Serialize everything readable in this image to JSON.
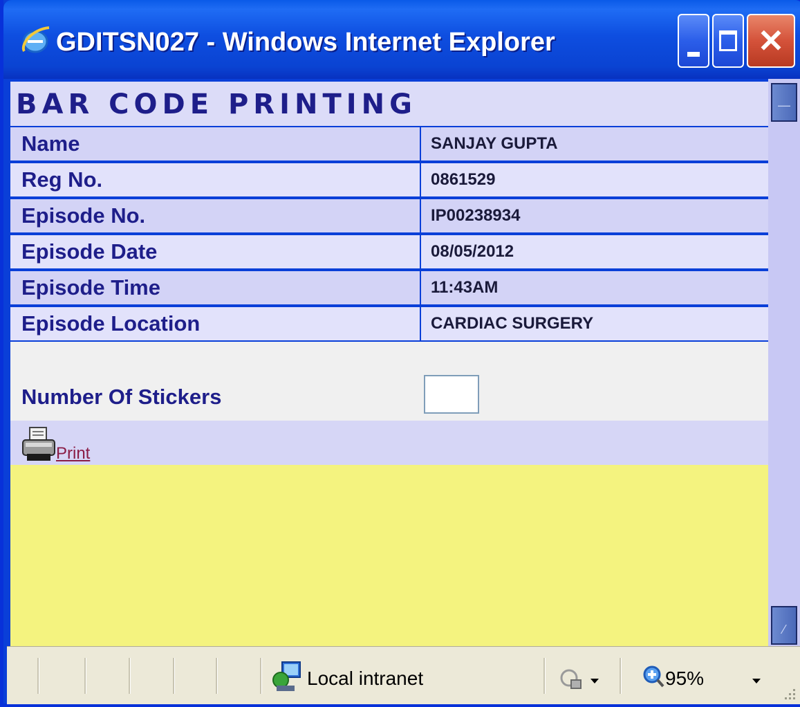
{
  "window": {
    "title": "GDITSN027 - Windows Internet Explorer"
  },
  "page": {
    "heading": "BAR CODE PRINTING",
    "fields": [
      {
        "label": "Name",
        "value": "SANJAY GUPTA"
      },
      {
        "label": "Reg No.",
        "value": "0861529"
      },
      {
        "label": "Episode No.",
        "value": "IP00238934"
      },
      {
        "label": "Episode Date",
        "value": "08/05/2012"
      },
      {
        "label": "Episode Time",
        "value": "11:43AM"
      },
      {
        "label": "Episode Location",
        "value": "CARDIAC SURGERY"
      }
    ],
    "stickers_label": "Number Of Stickers",
    "stickers_value": "",
    "print_label": "Print"
  },
  "statusbar": {
    "zone": "Local intranet",
    "zoom": "95%"
  },
  "colors": {
    "title_blue": "#0a43d2",
    "heading_text": "#1e1e8a",
    "row_a": "#d3d3f6",
    "row_b": "#e2e2fb",
    "content_yellow": "#f4f37f",
    "link": "#8a1c45"
  },
  "icons": [
    "ie-logo-icon",
    "minimize-icon",
    "maximize-icon",
    "close-icon",
    "printer-icon",
    "intranet-zone-icon",
    "protected-mode-lock-icon",
    "zoom-icon",
    "dropdown-arrow-icon",
    "resize-grip-icon",
    "scroll-up-icon",
    "scroll-down-icon"
  ]
}
